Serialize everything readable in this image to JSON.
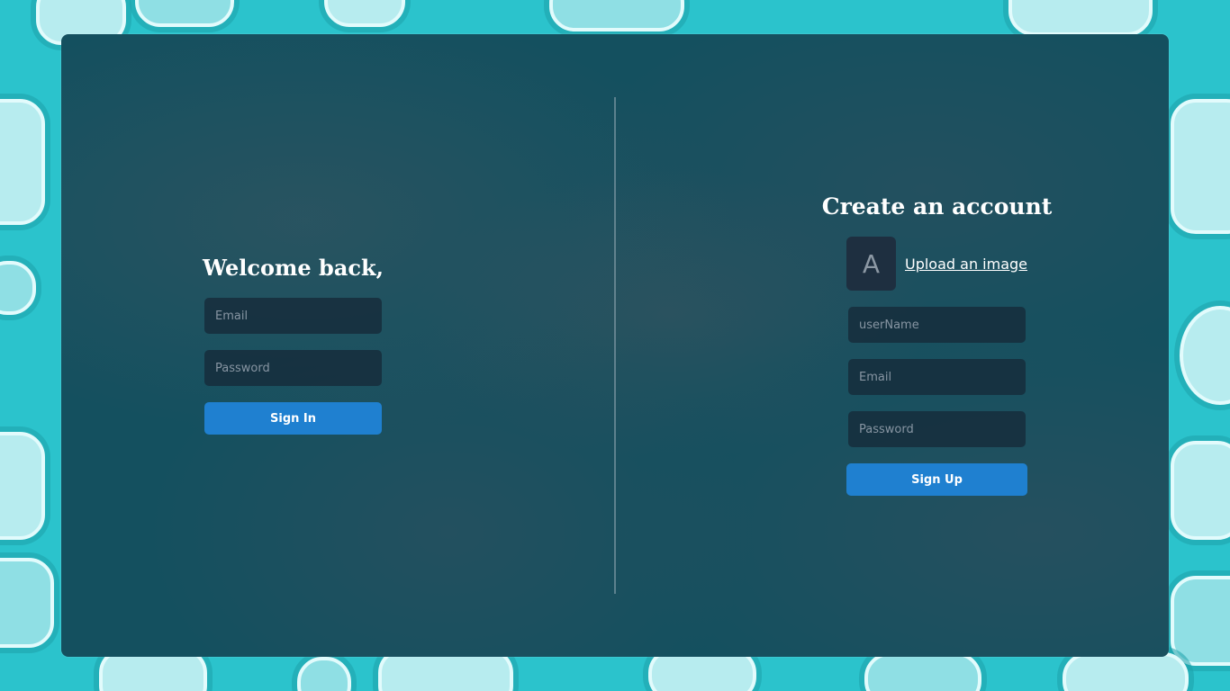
{
  "login": {
    "title": "Welcome back,",
    "email_placeholder": "Email",
    "password_placeholder": "Password",
    "submit_label": "Sign In"
  },
  "register": {
    "title": "Create an account",
    "avatar_letter": "A",
    "upload_label": "Upload an image",
    "username_placeholder": "userName",
    "email_placeholder": "Email",
    "password_placeholder": "Password",
    "submit_label": "Sign Up"
  },
  "colors": {
    "background": "#2bc3cc",
    "card": "#14505f",
    "button": "#1f80d0"
  }
}
